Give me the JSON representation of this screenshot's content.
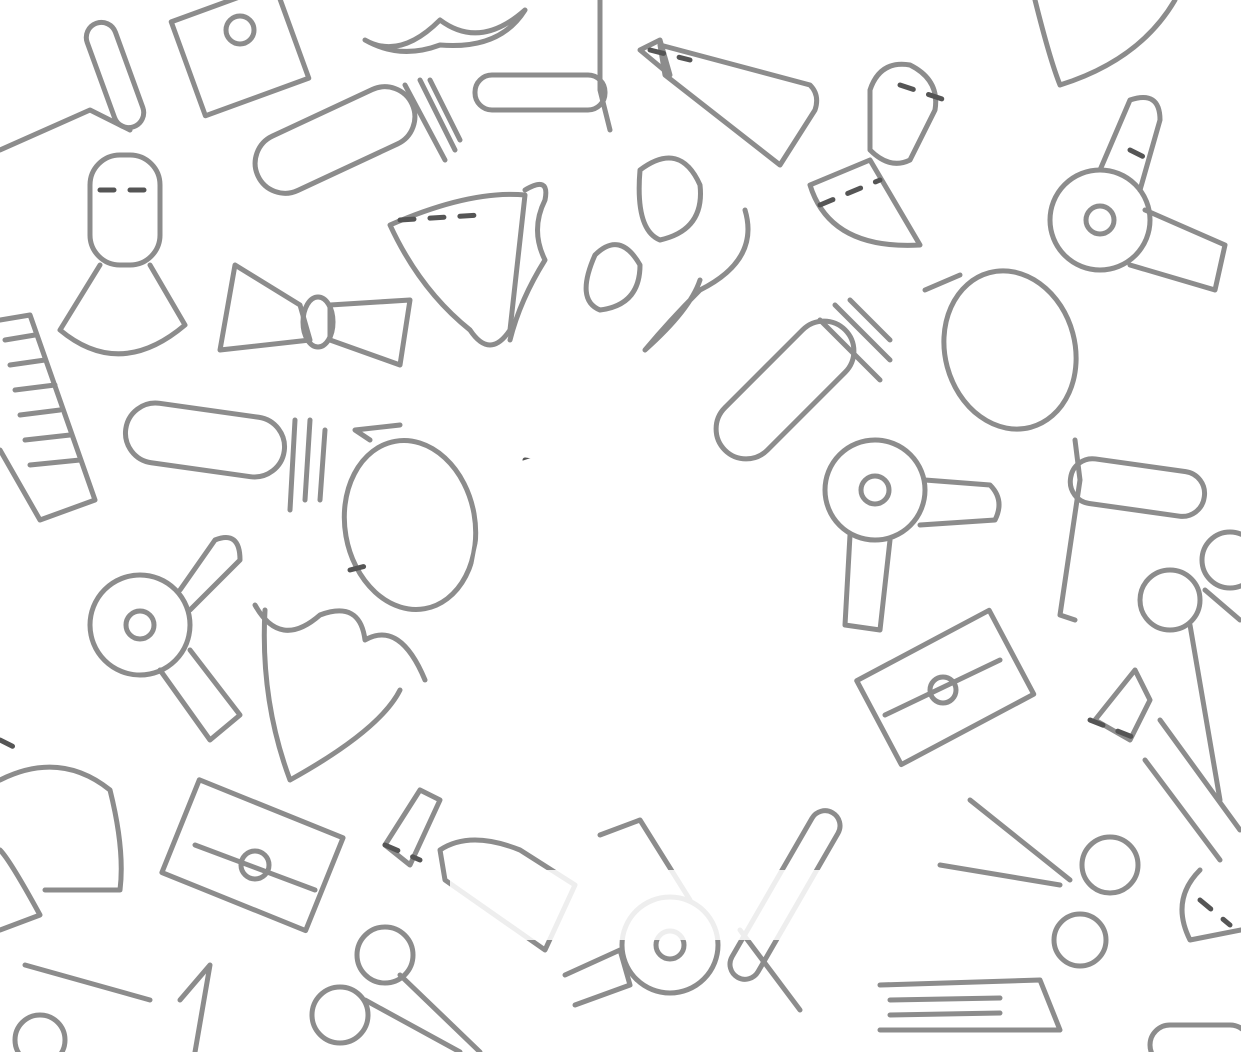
{
  "background_color": "#ffffff",
  "icon_stroke_color": "#8c8c8c",
  "icon_accent_color": "#555555",
  "logo_color": "#ffffff",
  "pattern_icons": [
    "straight-razor-icon",
    "shaving-brush-icon",
    "bow-tie-icon",
    "beard-icon",
    "mustache-icon",
    "hair-clipper-icon",
    "hand-mirror-icon",
    "hair-dryer-icon",
    "razor-blade-icon",
    "comb-icon",
    "scissors-icon",
    "barber-cape-icon",
    "spray-bottle-icon",
    "safety-razor-icon"
  ],
  "center_logo": {
    "icon": "barber-logo-icon"
  },
  "tagline": {
    "text": ""
  }
}
